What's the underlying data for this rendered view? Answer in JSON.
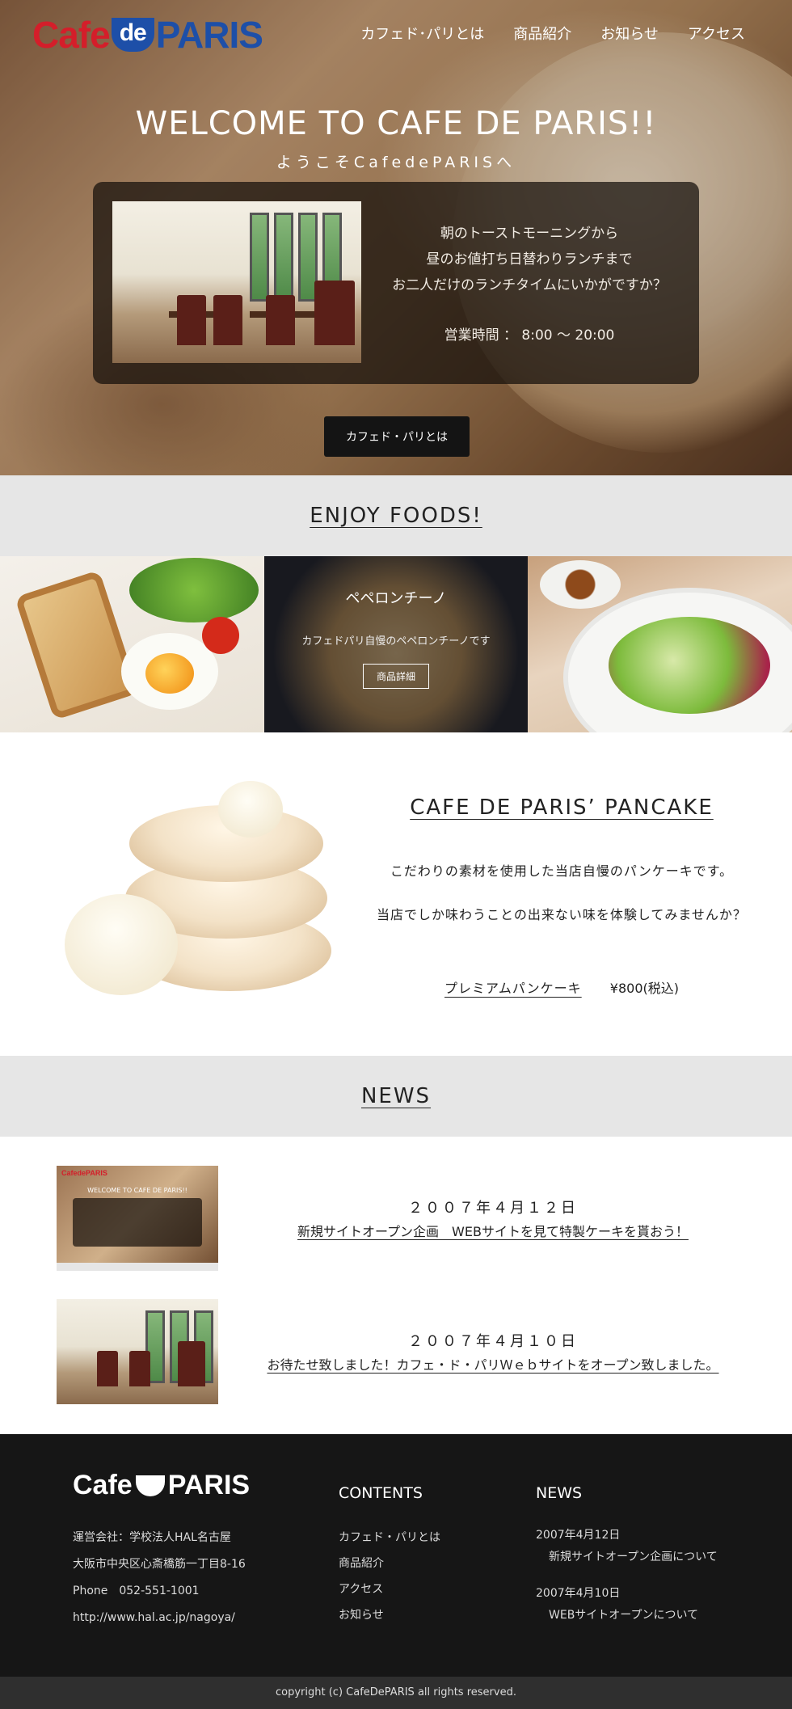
{
  "header": {
    "logo": {
      "cafe": "Cafe",
      "de": "de",
      "paris": "PARIS"
    },
    "nav": [
      "カフェド･パリとは",
      "商品紹介",
      "お知らせ",
      "アクセス"
    ]
  },
  "hero": {
    "title": "WELCOME TO CAFE DE PARIS!!",
    "subtitle": "ようこそCafedePARISへ",
    "lines": [
      "朝のトーストモーニングから",
      "昼のお値打ち日替わりランチまで",
      "お二人だけのランチタイムにいかがですか？"
    ],
    "hours": "営業時間 ： 8:00 ～ 20:00",
    "button": "カフェド・パリとは"
  },
  "foods": {
    "heading": "ENJOY FOODS!",
    "featured": {
      "name": "ペペロンチーノ",
      "desc": "カフェドパリ自慢のペペロンチーノです",
      "button": "商品詳細"
    }
  },
  "pancake": {
    "title": "CAFE DE PARIS’ PANCAKE",
    "desc1": "こだわりの素材を使用した当店自慢のパンケーキです。",
    "desc2": "当店でしか味わうことの出来ない味を体験してみませんか？",
    "product_link": "プレミアムパンケーキ",
    "price": "¥800(税込)"
  },
  "news": {
    "heading": "NEWS",
    "thumb1": {
      "logo": "CafedePARIS",
      "title": "WELCOME TO CAFE DE PARIS!!"
    },
    "items": [
      {
        "date": "２００７年４月１２日",
        "title": "新規サイトオープン企画　WEBサイトを見て特製ケーキを貰おう！"
      },
      {
        "date": "２００７年４月１０日",
        "title": "お待たせ致しました！カフェ・ド・パリＷｅｂサイトをオープン致しました。"
      }
    ]
  },
  "footer": {
    "logo": {
      "left": "Cafe",
      "right": "PARIS"
    },
    "info": [
      "運営会社：学校法人HAL名古屋",
      "大阪市中央区心斎橋筋一丁目8-16",
      "Phone　052-551-1001",
      "http://www.hal.ac.jp/nagoya/"
    ],
    "contents_title": "CONTENTS",
    "contents": [
      "カフェド・パリとは",
      "商品紹介",
      "アクセス",
      "お知らせ"
    ],
    "news_title": "NEWS",
    "news": [
      {
        "date": "2007年4月12日",
        "title": "新規サイトオープン企画について"
      },
      {
        "date": "2007年4月10日",
        "title": "WEBサイトオープンについて"
      }
    ],
    "copyright": "copyright (c) CafeDePARIS all rights reserved."
  }
}
